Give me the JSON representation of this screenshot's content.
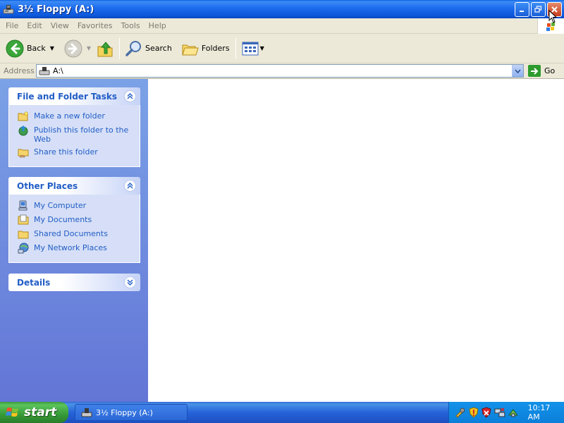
{
  "window": {
    "title": "3½ Floppy (A:)",
    "icon": "floppy-drive-icon"
  },
  "menu": [
    "File",
    "Edit",
    "View",
    "Favorites",
    "Tools",
    "Help"
  ],
  "toolbar": {
    "back_label": "Back",
    "search_label": "Search",
    "folders_label": "Folders"
  },
  "address": {
    "label": "Address",
    "value": "A:\\",
    "go_label": "Go"
  },
  "panels": {
    "file_tasks": {
      "title": "File and Folder Tasks",
      "items": [
        {
          "label": "Make a new folder",
          "icon": "new-folder-icon"
        },
        {
          "label": "Publish this folder to the Web",
          "icon": "publish-web-icon"
        },
        {
          "label": "Share this folder",
          "icon": "share-folder-icon"
        }
      ]
    },
    "other_places": {
      "title": "Other Places",
      "items": [
        {
          "label": "My Computer",
          "icon": "my-computer-icon"
        },
        {
          "label": "My Documents",
          "icon": "my-documents-icon"
        },
        {
          "label": "Shared Documents",
          "icon": "shared-documents-icon"
        },
        {
          "label": "My Network Places",
          "icon": "network-places-icon"
        }
      ]
    },
    "details": {
      "title": "Details"
    }
  },
  "taskbar": {
    "start_label": "start",
    "task_label": "3½ Floppy (A:)",
    "clock": "10:17 AM"
  },
  "colors": {
    "title_bar": "#0b55d9",
    "task_pane": "#6f8ee0",
    "link": "#215dc6",
    "start_green": "#379a37"
  }
}
